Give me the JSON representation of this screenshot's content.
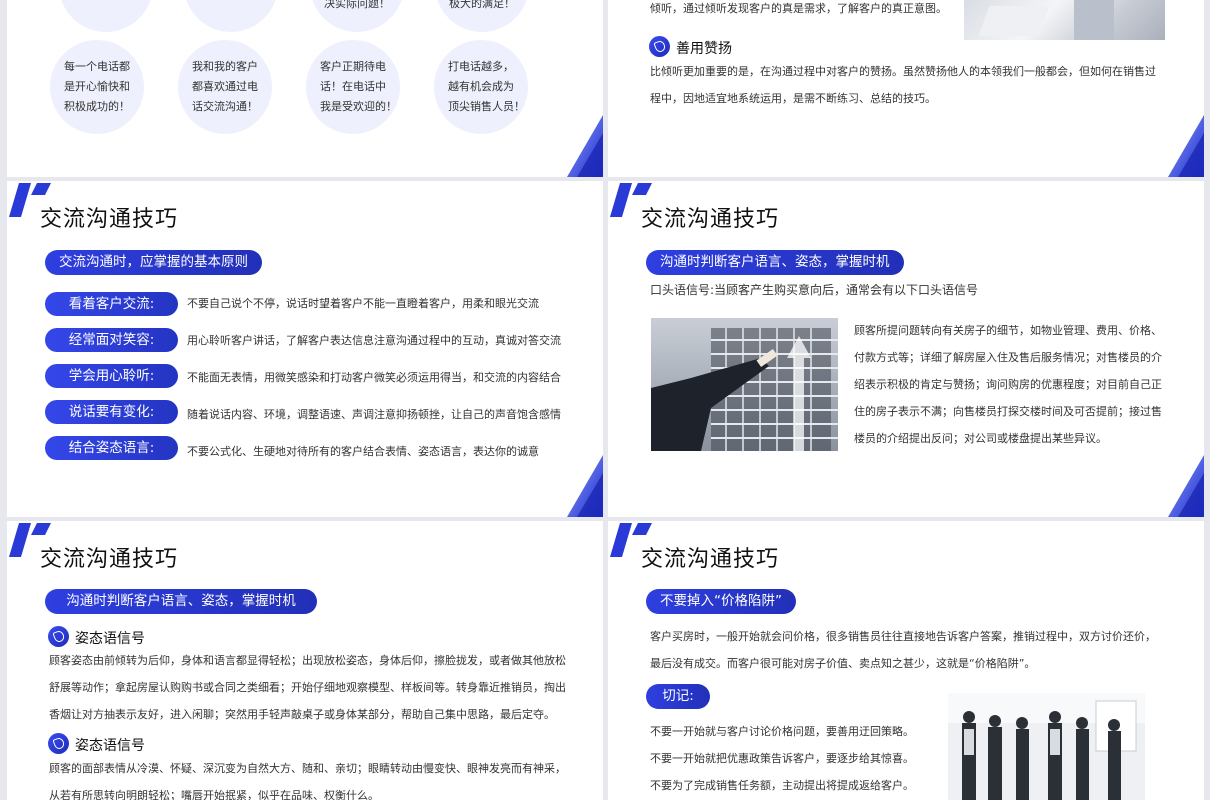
{
  "colors": {
    "accent": "#2a3ad6",
    "accent_light": "#eef0fd"
  },
  "slide1": {
    "circles_top": [
      "决实际问题！",
      "极大的满足！"
    ],
    "circles": [
      {
        "lines": [
          "每一个电话都",
          "是开心愉快和",
          "积极成功的！"
        ]
      },
      {
        "lines": [
          "我和我的客户",
          "都喜欢通过电",
          "话交流沟通！"
        ]
      },
      {
        "lines": [
          "客户正期待电",
          "话！在电话中",
          "我是受欢迎的！"
        ]
      },
      {
        "lines": [
          "打电话越多，",
          "越有机会成为",
          "顶尖销售人员！"
        ]
      }
    ]
  },
  "slide2": {
    "top_text": "倾听，通过倾听发现客户的真是需求，了解客户的真正意图。",
    "subheading": "善用赞扬",
    "para_lines": [
      "比倾听更加重要的是，在沟通过程中对客户的赞扬。虽然赞扬他人的本领我们一般都会，但如何在销售过",
      "程中，因地适宜地系统运用，是需不断练习、总结的技巧。"
    ]
  },
  "slide3": {
    "title": "交流沟通技巧",
    "pill": "交流沟通时，应掌握的基本原则",
    "rows": [
      {
        "label": "看着客户交流:",
        "text": "不要自己说个不停，说话时望着客户不能一直瞪着客户，用柔和眼光交流"
      },
      {
        "label": "经常面对笑容:",
        "text": "用心聆听客户讲话，了解客户表达信息注意沟通过程中的互动，真诚对答交流"
      },
      {
        "label": "学会用心聆听:",
        "text": "不能面无表情，用微笑感染和打动客户微笑必须运用得当，和交流的内容结合"
      },
      {
        "label": "说话要有变化:",
        "text": "随着说话内容、环境，调整语速、声调注意抑扬顿挫，让自己的声音饱含感情"
      },
      {
        "label": "结合姿态语言:",
        "text": "不要公式化、生硬地对待所有的客户结合表情、姿态语言，表达你的诚意"
      }
    ]
  },
  "slide4": {
    "title": "交流沟通技巧",
    "pill": "沟通时判断客户语言、姿态，掌握时机",
    "intro": "口头语信号:当顾客产生购买意向后，通常会有以下口头语信号",
    "para_lines": [
      "顾客所提问题转向有关房子的细节，如物业管理、费用、价格、",
      "付款方式等；详细了解房屋入住及售后服务情况；对售楼员的介",
      "绍表示积极的肯定与赞扬；询问购房的优惠程度；对目前自己正",
      "住的房子表示不满；向售楼员打探交楼时间及可否提前；接过售",
      "楼员的介绍提出反问；对公司或楼盘提出某些异议。"
    ]
  },
  "slide5": {
    "title": "交流沟通技巧",
    "pill": "沟通时判断客户语言、姿态，掌握时机",
    "sub1": "姿态语信号",
    "para1_lines": [
      "顾客姿态由前倾转为后仰，身体和语言都显得轻松；出现放松姿态，身体后仰，擦脸拢发，或者做其他放松",
      "舒展等动作；拿起房屋认购购书或合同之类细看；开始仔细地观察模型、样板间等。转身靠近推销员，掏出",
      "香烟让对方抽表示友好，进入闲聊；突然用手轻声敲桌子或身体某部分，帮助自己集中思路，最后定夺。"
    ],
    "sub2": "姿态语信号",
    "para2_lines": [
      "顾客的面部表情从冷漠、怀疑、深沉变为自然大方、随和、亲切；眼睛转动由慢变快、眼神发亮而有神采，",
      "从若有所思转向明朗轻松；嘴唇开始抿紧，似乎在品味、权衡什么。"
    ]
  },
  "slide6": {
    "title": "交流沟通技巧",
    "pill1": "不要掉入“价格陷阱”",
    "para_lines": [
      "客户买房时，一般开始就会问价格，很多销售员往往直接地告诉客户答案，推销过程中，双方讨价还价，",
      "最后没有成交。而客户很可能对房子价值、卖点知之甚少，这就是“价格陷阱”。"
    ],
    "pill2": "切记:",
    "tips": [
      "不要一开始就与客户讨论价格问题，要善用迂回策略。",
      "不要一开始就把优惠政策告诉客户，要逐步给其惊喜。",
      "不要为了完成销售任务额，主动提出将提成返给客户。"
    ]
  }
}
